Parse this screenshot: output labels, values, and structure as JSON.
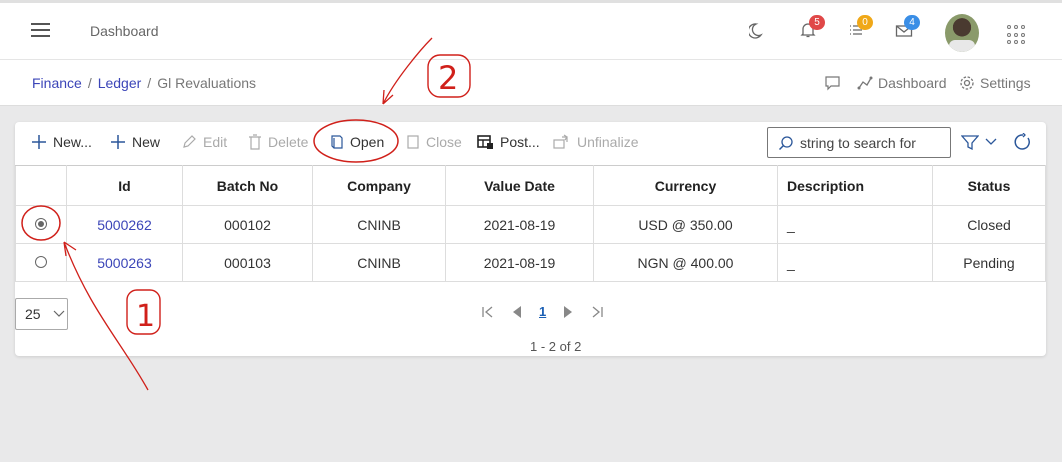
{
  "topbar": {
    "title": "Dashboard",
    "badges": {
      "notifications": "5",
      "tasks": "0",
      "messages": "4"
    },
    "badge_colors": {
      "notifications": "#e04848",
      "tasks": "#f0a818",
      "messages": "#3a8ee6"
    }
  },
  "breadcrumb": {
    "items": [
      "Finance",
      "Ledger"
    ],
    "current": "Gl Revaluations",
    "dashboard_label": "Dashboard",
    "settings_label": "Settings"
  },
  "toolbar": {
    "new_dropdown": "New...",
    "new": "New",
    "edit": "Edit",
    "delete": "Delete",
    "open": "Open",
    "close": "Close",
    "post": "Post...",
    "unfinalize": "Unfinalize",
    "search_placeholder": "string to search for"
  },
  "table": {
    "columns": [
      "Id",
      "Batch No",
      "Company",
      "Value Date",
      "Currency",
      "Description",
      "Status"
    ],
    "rows": [
      {
        "selected": true,
        "id": "5000262",
        "batch": "000102",
        "company": "CNINB",
        "date": "2021-08-19",
        "currency": "USD @ 350.00",
        "desc": "_",
        "status": "Closed"
      },
      {
        "selected": false,
        "id": "5000263",
        "batch": "000103",
        "company": "CNINB",
        "date": "2021-08-19",
        "currency": "NGN @ 400.00",
        "desc": "_",
        "status": "Pending"
      }
    ]
  },
  "pager": {
    "page_size": "25",
    "current_page": "1",
    "info": "1 - 2 of 2"
  },
  "annotations": {
    "label_one": "1",
    "label_two": "2",
    "color": "#d0201a"
  },
  "colors": {
    "accent": "#3b45b8",
    "link": "#1a5fb4"
  }
}
